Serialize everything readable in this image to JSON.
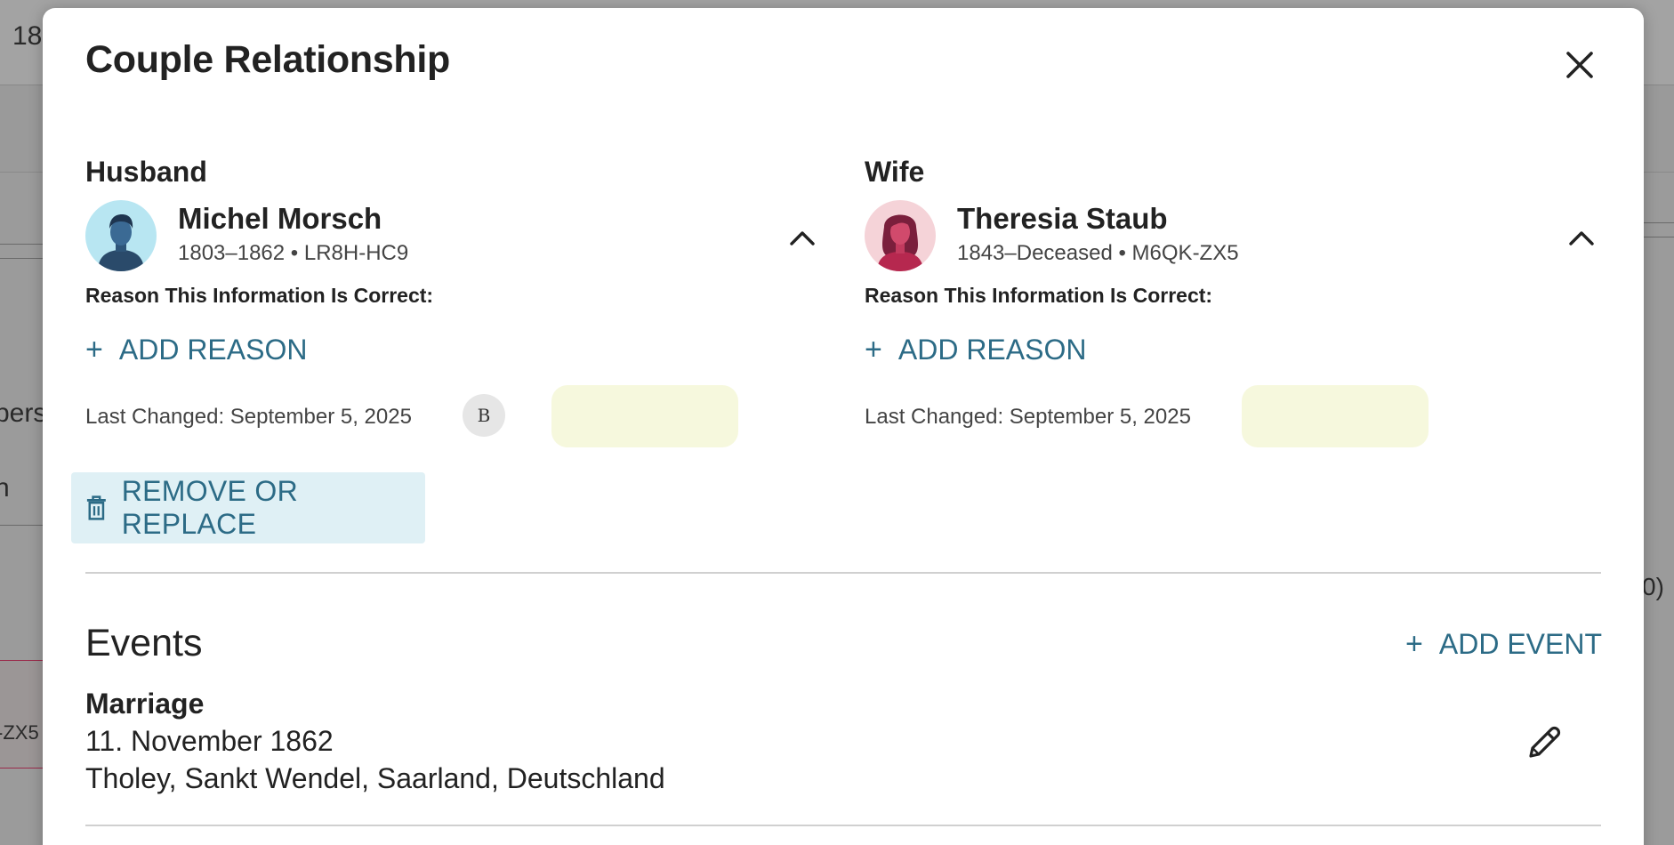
{
  "background": {
    "fragments": [
      "18",
      "pers",
      "n",
      "0)",
      "-ZX5"
    ]
  },
  "modal": {
    "title": "Couple Relationship",
    "close_icon": "close-icon",
    "husband": {
      "role_label": "Husband",
      "name": "Michel Morsch",
      "meta": "1803–1862 • LR8H-HC9",
      "reason_label": "Reason This Information Is Correct:",
      "add_reason_label": "ADD REASON",
      "last_changed": "Last Changed: September 5, 2025",
      "contributor_badge": "B",
      "remove_label": "REMOVE OR REPLACE"
    },
    "wife": {
      "role_label": "Wife",
      "name": "Theresia Staub",
      "meta": "1843–Deceased • M6QK-ZX5",
      "reason_label": "Reason This Information Is Correct:",
      "add_reason_label": "ADD REASON",
      "last_changed": "Last Changed: September 5, 2025"
    },
    "events": {
      "title": "Events",
      "add_event_label": "ADD EVENT",
      "items": [
        {
          "type": "Marriage",
          "date": "11. November 1862",
          "place": "Tholey, Sankt Wendel, Saarland, Deutschland"
        }
      ]
    }
  },
  "colors": {
    "accent": "#2c6b86",
    "remove_bg": "#dff0f5",
    "highlight": "#f6f8dd",
    "male_avatar_bg": "#b8e6f2",
    "female_avatar_bg": "#f5d3d8"
  }
}
